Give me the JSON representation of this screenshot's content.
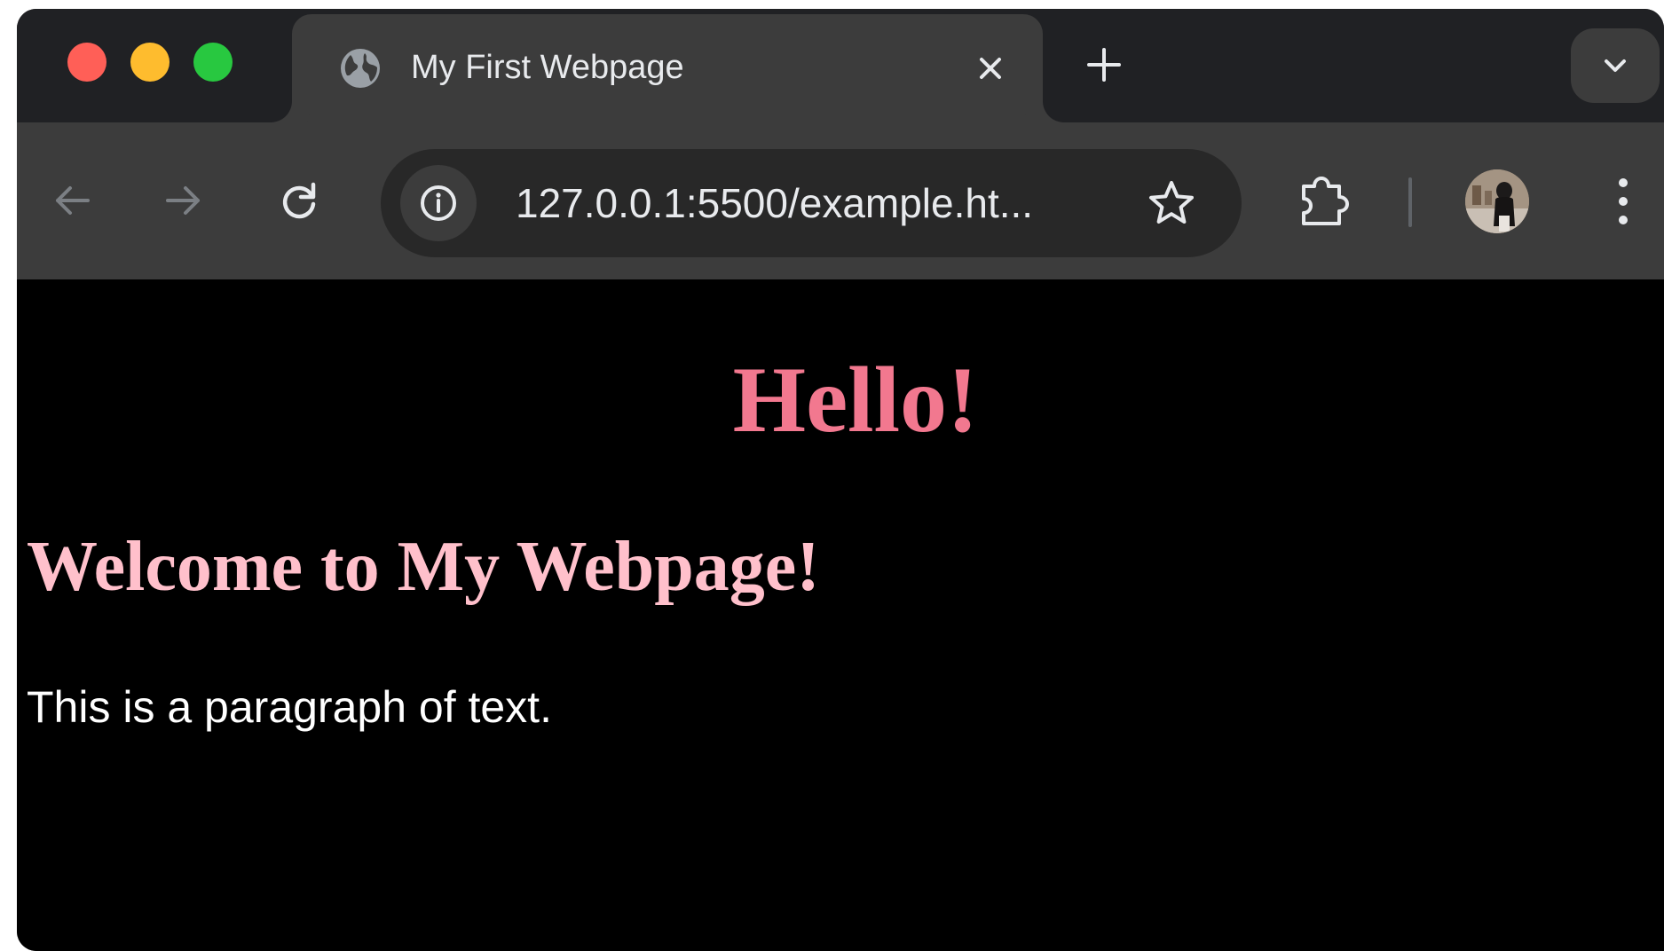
{
  "browser": {
    "tab": {
      "title": "My First Webpage",
      "favicon": "globe-icon"
    },
    "toolbar": {
      "url": "127.0.0.1:5500/example.ht..."
    },
    "icons": {
      "close": "close-icon",
      "new_tab": "plus-icon",
      "dropdown": "chevron-down-icon",
      "back": "arrow-left-icon",
      "forward": "arrow-right-icon",
      "reload": "reload-icon",
      "site_info": "info-icon",
      "bookmark": "star-icon",
      "extensions": "puzzle-icon",
      "menu": "kebab-menu-icon"
    }
  },
  "page": {
    "heading": "Hello!",
    "subheading": "Welcome to My Webpage!",
    "paragraph": "This is a paragraph of text."
  },
  "colors": {
    "heading": "#f2788f",
    "subheading": "#ffc0cb",
    "paragraph": "#ffffff",
    "page_background": "#000000"
  }
}
